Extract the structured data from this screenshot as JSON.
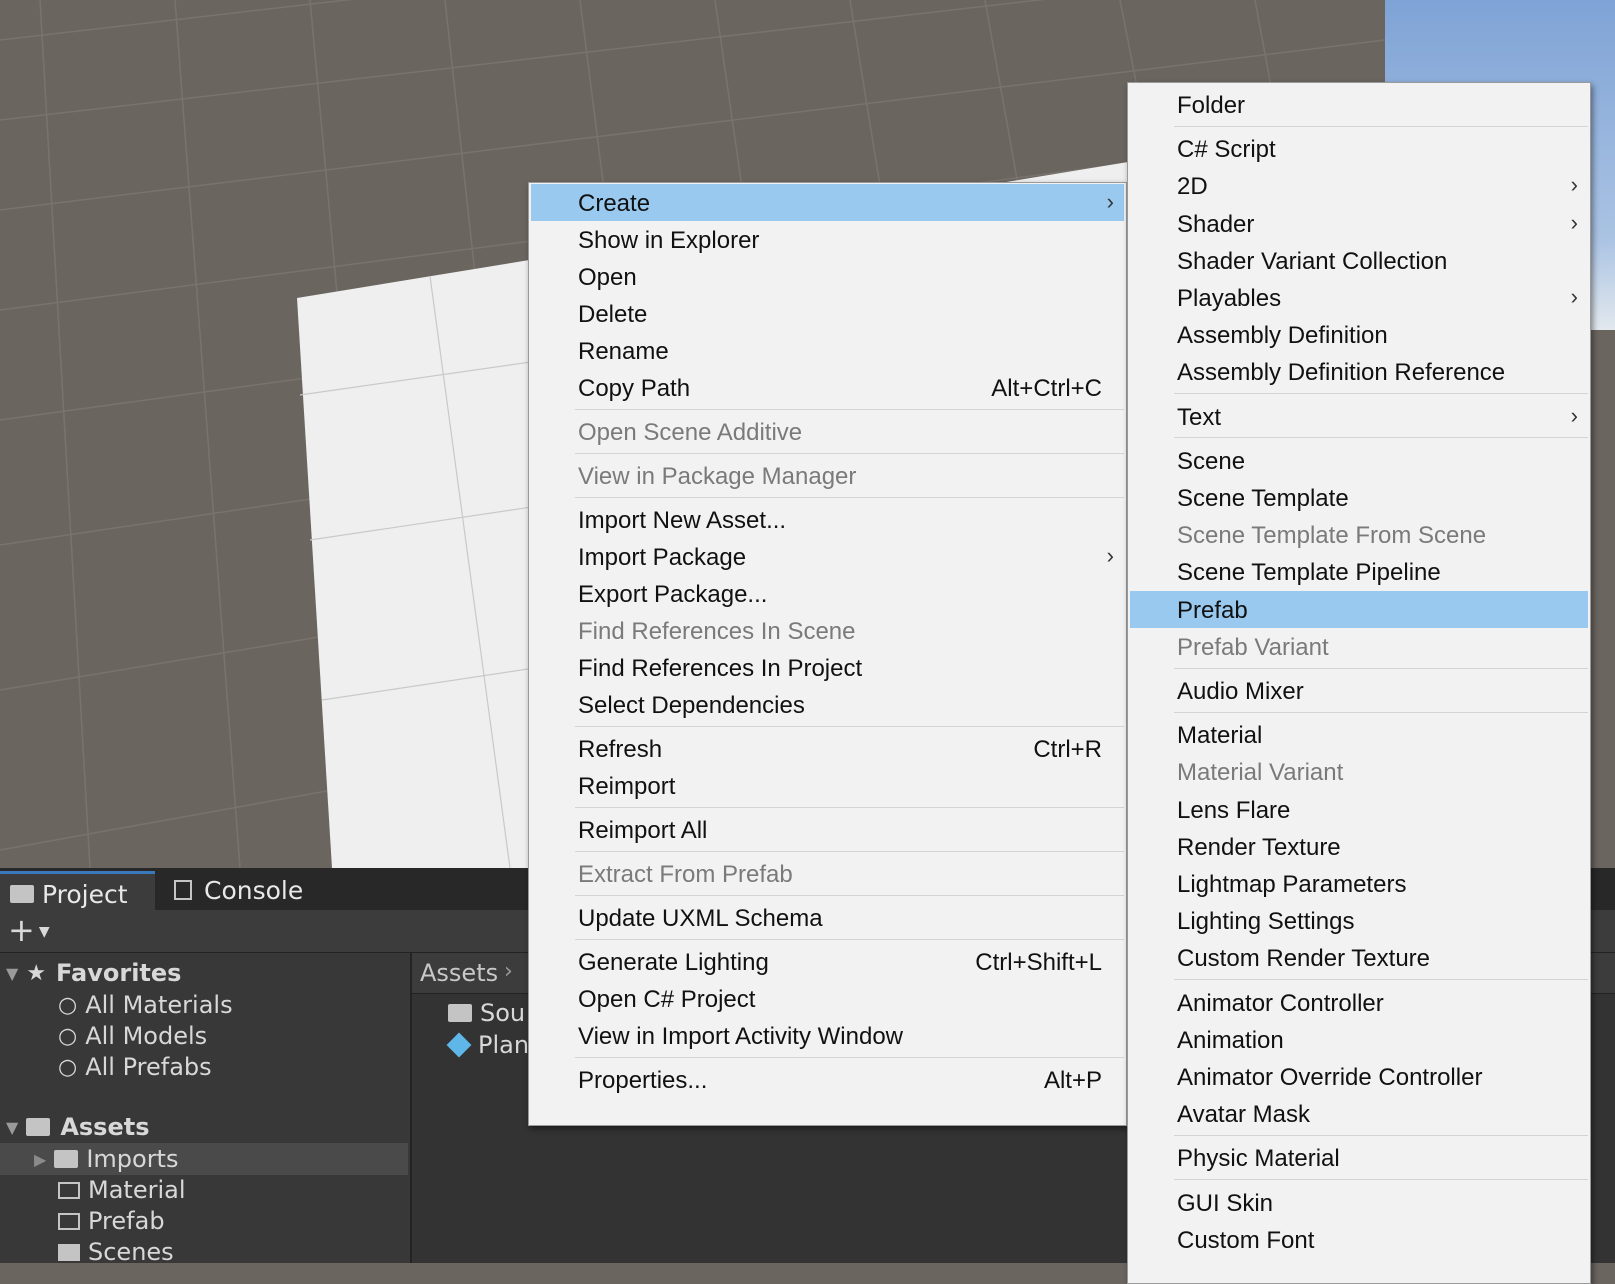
{
  "scene_view": {
    "name": "scene-view"
  },
  "project_panel": {
    "tabs": [
      {
        "label": "Project",
        "icon": "folder-icon",
        "active": true
      },
      {
        "label": "Console",
        "icon": "console-icon",
        "active": false
      }
    ],
    "favorites": {
      "label": "Favorites",
      "items": [
        "All Materials",
        "All Models",
        "All Prefabs"
      ]
    },
    "assets": {
      "label": "Assets",
      "items": [
        "Imports",
        "Material",
        "Prefab",
        "Scenes"
      ]
    },
    "breadcrumb": "Assets",
    "content_items": [
      "Sou",
      "Plan"
    ]
  },
  "context_menu": {
    "items": [
      {
        "label": "Create",
        "submenu": true,
        "selected": true
      },
      {
        "label": "Show in Explorer"
      },
      {
        "label": "Open"
      },
      {
        "label": "Delete"
      },
      {
        "label": "Rename"
      },
      {
        "label": "Copy Path",
        "shortcut": "Alt+Ctrl+C"
      },
      {
        "separator": true
      },
      {
        "label": "Open Scene Additive",
        "disabled": true
      },
      {
        "separator": true
      },
      {
        "label": "View in Package Manager",
        "disabled": true
      },
      {
        "separator": true
      },
      {
        "label": "Import New Asset..."
      },
      {
        "label": "Import Package",
        "submenu": true
      },
      {
        "label": "Export Package..."
      },
      {
        "label": "Find References In Scene",
        "disabled": true
      },
      {
        "label": "Find References In Project"
      },
      {
        "label": "Select Dependencies"
      },
      {
        "separator": true
      },
      {
        "label": "Refresh",
        "shortcut": "Ctrl+R"
      },
      {
        "label": "Reimport"
      },
      {
        "separator": true
      },
      {
        "label": "Reimport All"
      },
      {
        "separator": true
      },
      {
        "label": "Extract From Prefab",
        "disabled": true
      },
      {
        "separator": true
      },
      {
        "label": "Update UXML Schema"
      },
      {
        "separator": true
      },
      {
        "label": "Generate Lighting",
        "shortcut": "Ctrl+Shift+L"
      },
      {
        "label": "Open C# Project"
      },
      {
        "label": "View in Import Activity Window"
      },
      {
        "separator": true
      },
      {
        "label": "Properties...",
        "shortcut": "Alt+P"
      }
    ]
  },
  "create_submenu": {
    "items": [
      {
        "label": "Folder"
      },
      {
        "separator": true
      },
      {
        "label": "C# Script"
      },
      {
        "label": "2D",
        "submenu": true
      },
      {
        "label": "Shader",
        "submenu": true
      },
      {
        "label": "Shader Variant Collection"
      },
      {
        "label": "Playables",
        "submenu": true
      },
      {
        "label": "Assembly Definition"
      },
      {
        "label": "Assembly Definition Reference"
      },
      {
        "separator": true
      },
      {
        "label": "Text",
        "submenu": true
      },
      {
        "separator": true
      },
      {
        "label": "Scene"
      },
      {
        "label": "Scene Template"
      },
      {
        "label": "Scene Template From Scene",
        "disabled": true
      },
      {
        "label": "Scene Template Pipeline"
      },
      {
        "label": "Prefab",
        "selected": true
      },
      {
        "label": "Prefab Variant",
        "disabled": true
      },
      {
        "separator": true
      },
      {
        "label": "Audio Mixer"
      },
      {
        "separator": true
      },
      {
        "label": "Material"
      },
      {
        "label": "Material Variant",
        "disabled": true
      },
      {
        "label": "Lens Flare"
      },
      {
        "label": "Render Texture"
      },
      {
        "label": "Lightmap Parameters"
      },
      {
        "label": "Lighting Settings"
      },
      {
        "label": "Custom Render Texture"
      },
      {
        "separator": true
      },
      {
        "label": "Animator Controller"
      },
      {
        "label": "Animation"
      },
      {
        "label": "Animator Override Controller"
      },
      {
        "label": "Avatar Mask"
      },
      {
        "separator": true
      },
      {
        "label": "Physic Material"
      },
      {
        "separator": true
      },
      {
        "label": "GUI Skin"
      },
      {
        "label": "Custom Font"
      }
    ]
  },
  "colors": {
    "menu_bg": "#f2f2f2",
    "menu_selected": "#99c9ef",
    "disabled_text": "#7a7a7a",
    "panel_bg": "#383838"
  }
}
